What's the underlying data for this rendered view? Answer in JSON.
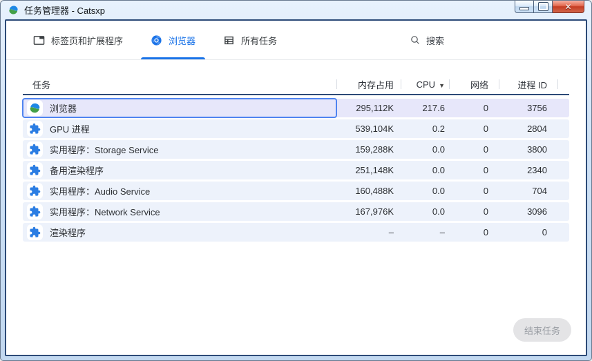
{
  "window": {
    "title": "任务管理器 - Catsxp",
    "controls": [
      "minimize",
      "maximize",
      "close"
    ]
  },
  "tabs": [
    {
      "label": "标签页和扩展程序",
      "icon": "tabs-and-extensions-icon",
      "active": false
    },
    {
      "label": "浏览器",
      "icon": "browser-icon",
      "active": true
    },
    {
      "label": "所有任务",
      "icon": "all-tasks-icon",
      "active": false
    }
  ],
  "search": {
    "label": "搜索",
    "icon": "search-icon"
  },
  "table": {
    "columns": [
      "任务",
      "内存占用",
      "CPU",
      "网络",
      "进程 ID"
    ],
    "sort_column": "CPU",
    "sort_indicator": "▼",
    "rows": [
      {
        "icon": "catsxp-logo",
        "task": "浏览器",
        "memory": "295,112K",
        "cpu": "217.6",
        "network": "0",
        "pid": "3756",
        "selected": true
      },
      {
        "icon": "extension-puzzle-icon",
        "task": "GPU 进程",
        "memory": "539,104K",
        "cpu": "0.2",
        "network": "0",
        "pid": "2804",
        "selected": false
      },
      {
        "icon": "extension-puzzle-icon",
        "task": "实用程序：Storage Service",
        "memory": "159,288K",
        "cpu": "0.0",
        "network": "0",
        "pid": "3800",
        "selected": false
      },
      {
        "icon": "extension-puzzle-icon",
        "task": "备用渲染程序",
        "memory": "251,148K",
        "cpu": "0.0",
        "network": "0",
        "pid": "2340",
        "selected": false
      },
      {
        "icon": "extension-puzzle-icon",
        "task": "实用程序：Audio Service",
        "memory": "160,488K",
        "cpu": "0.0",
        "network": "0",
        "pid": "704",
        "selected": false
      },
      {
        "icon": "extension-puzzle-icon",
        "task": "实用程序：Network Service",
        "memory": "167,976K",
        "cpu": "0.0",
        "network": "0",
        "pid": "3096",
        "selected": false
      },
      {
        "icon": "extension-puzzle-icon",
        "task": "渲染程序",
        "memory": "–",
        "cpu": "–",
        "network": "0",
        "pid": "0",
        "selected": false
      }
    ]
  },
  "footer": {
    "end_task_label": "结束任务",
    "end_task_enabled": false
  },
  "colors": {
    "accent": "#1a73e8",
    "row_bg": "#edf2fb",
    "selected_row_bg": "#e7e7fa",
    "focus_ring": "#4f84f0",
    "header_border": "#2c4a77",
    "close_button": "#c53b22",
    "logo_blue": "#1e88e5",
    "logo_green": "#43a047",
    "puzzle_blue": "#2b7de3"
  }
}
